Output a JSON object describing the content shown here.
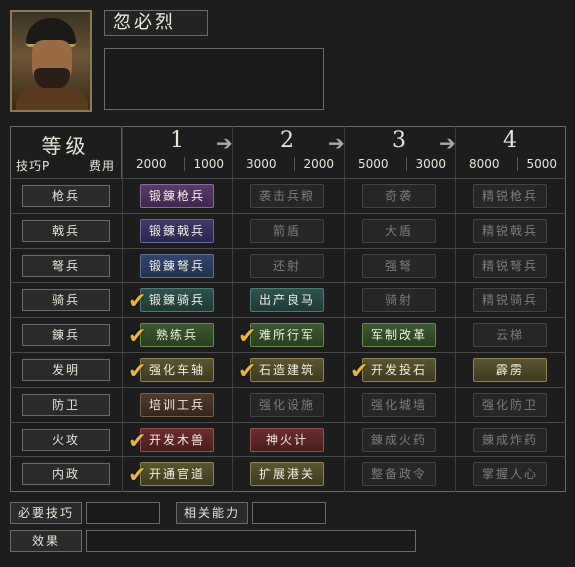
{
  "general": {
    "name": "忽必烈"
  },
  "header": {
    "level_label": "等级",
    "skill_p_label": "技巧P",
    "cost_label": "费用"
  },
  "levels": [
    {
      "num": "1",
      "cost_a": "2000",
      "cost_b": "1000"
    },
    {
      "num": "2",
      "cost_a": "3000",
      "cost_b": "2000"
    },
    {
      "num": "3",
      "cost_a": "5000",
      "cost_b": "3000"
    },
    {
      "num": "4",
      "cost_a": "8000",
      "cost_b": "5000"
    }
  ],
  "rows": [
    {
      "label": "枪兵",
      "cells": [
        {
          "text": "锻錬枪兵",
          "style": "purple",
          "checked": false,
          "active": true
        },
        {
          "text": "袭击兵粮",
          "style": "dim",
          "checked": false,
          "active": false
        },
        {
          "text": "奇袭",
          "style": "dim",
          "checked": false,
          "active": false
        },
        {
          "text": "精锐枪兵",
          "style": "dim",
          "checked": false,
          "active": false
        }
      ]
    },
    {
      "label": "戟兵",
      "cells": [
        {
          "text": "锻錬戟兵",
          "style": "indigo",
          "checked": false,
          "active": true
        },
        {
          "text": "箭盾",
          "style": "dim",
          "checked": false,
          "active": false
        },
        {
          "text": "大盾",
          "style": "dim",
          "checked": false,
          "active": false
        },
        {
          "text": "精锐戟兵",
          "style": "dim",
          "checked": false,
          "active": false
        }
      ]
    },
    {
      "label": "弩兵",
      "cells": [
        {
          "text": "锻錬弩兵",
          "style": "blue",
          "checked": false,
          "active": true
        },
        {
          "text": "还射",
          "style": "dim",
          "checked": false,
          "active": false
        },
        {
          "text": "强弩",
          "style": "dim",
          "checked": false,
          "active": false
        },
        {
          "text": "精锐弩兵",
          "style": "dim",
          "checked": false,
          "active": false
        }
      ]
    },
    {
      "label": "骑兵",
      "cells": [
        {
          "text": "锻錬骑兵",
          "style": "teal",
          "checked": true,
          "active": true
        },
        {
          "text": "出产良马",
          "style": "teal",
          "checked": false,
          "active": true
        },
        {
          "text": "骑射",
          "style": "dim",
          "checked": false,
          "active": false
        },
        {
          "text": "精锐骑兵",
          "style": "dim",
          "checked": false,
          "active": false
        }
      ]
    },
    {
      "label": "錬兵",
      "cells": [
        {
          "text": "熟练兵",
          "style": "green",
          "checked": true,
          "active": true
        },
        {
          "text": "难所行军",
          "style": "green",
          "checked": true,
          "active": true
        },
        {
          "text": "军制改革",
          "style": "green",
          "checked": false,
          "active": true
        },
        {
          "text": "云梯",
          "style": "dim",
          "checked": false,
          "active": false
        }
      ]
    },
    {
      "label": "发明",
      "cells": [
        {
          "text": "强化车轴",
          "style": "olive",
          "checked": true,
          "active": true
        },
        {
          "text": "石造建筑",
          "style": "olive",
          "checked": true,
          "active": true
        },
        {
          "text": "开发投石",
          "style": "olive",
          "checked": true,
          "active": true
        },
        {
          "text": "霹雳",
          "style": "olive",
          "checked": false,
          "active": true
        }
      ]
    },
    {
      "label": "防卫",
      "cells": [
        {
          "text": "培训工兵",
          "style": "brown",
          "checked": false,
          "active": true
        },
        {
          "text": "强化设施",
          "style": "dim",
          "checked": false,
          "active": false
        },
        {
          "text": "强化城墙",
          "style": "dim",
          "checked": false,
          "active": false
        },
        {
          "text": "强化防卫",
          "style": "dim",
          "checked": false,
          "active": false
        }
      ]
    },
    {
      "label": "火攻",
      "cells": [
        {
          "text": "开发木兽",
          "style": "red",
          "checked": true,
          "active": true
        },
        {
          "text": "神火计",
          "style": "red",
          "checked": false,
          "active": true
        },
        {
          "text": "錬成火药",
          "style": "dim",
          "checked": false,
          "active": false
        },
        {
          "text": "錬成炸药",
          "style": "dim",
          "checked": false,
          "active": false
        }
      ]
    },
    {
      "label": "内政",
      "cells": [
        {
          "text": "开通官道",
          "style": "olive",
          "checked": true,
          "active": true
        },
        {
          "text": "扩展港关",
          "style": "olive",
          "checked": false,
          "active": true
        },
        {
          "text": "整备政令",
          "style": "dim",
          "checked": false,
          "active": false
        },
        {
          "text": "掌握人心",
          "style": "dim",
          "checked": false,
          "active": false
        }
      ]
    }
  ],
  "footer": {
    "required_label": "必要技巧",
    "related_label": "相关能力",
    "effect_label": "效果"
  },
  "colors": {
    "check": "#e9b43a",
    "background": "#1d1d1d"
  }
}
